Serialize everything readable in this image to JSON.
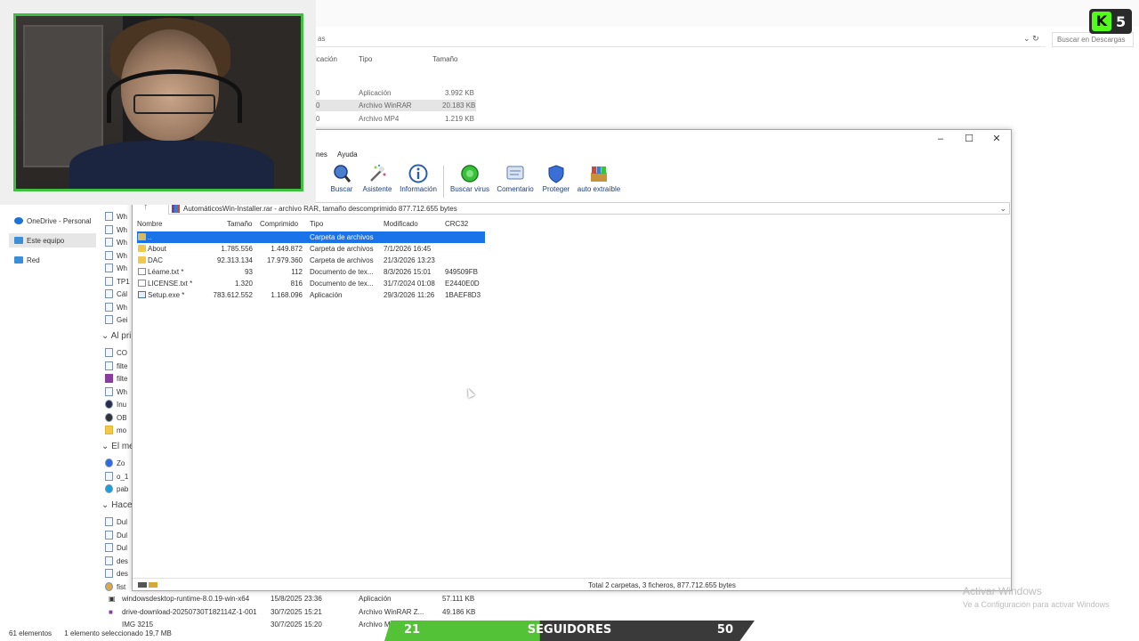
{
  "explorer": {
    "search_placeholder": "Buscar en Descargas",
    "address_fragment": "as",
    "columns": [
      "ificación",
      "Tipo",
      "Tamaño"
    ],
    "top_rows": [
      {
        "date_frag": "0",
        "type": "Aplicación",
        "size": "3.992 KB",
        "selected": false
      },
      {
        "date_frag": "0",
        "type": "Archivo WinRAR",
        "size": "20.183 KB",
        "selected": true
      },
      {
        "date_frag": "0",
        "type": "Archivo MP4",
        "size": "1.219 KB",
        "selected": false
      }
    ],
    "sidebar": [
      {
        "label": "OneDrive - Personal",
        "color": "#1e73d8"
      },
      {
        "label": "Este equipo",
        "color": "#3a8fd8",
        "selected": true
      },
      {
        "label": "Red",
        "color": "#3a8fd8"
      }
    ],
    "peek_items_top": [
      "Wh",
      "Wh",
      "Wh",
      "Wh",
      "Wh",
      "TP1",
      "Cál",
      "Wh",
      "Gei"
    ],
    "group_1": "Al pri",
    "peek_items_mid": [
      "CO",
      "filte",
      "filte",
      "Wh",
      "Inu",
      "OB",
      "mo"
    ],
    "group_2": "El me",
    "peek_items_mid2": [
      "Zo",
      "o_1",
      "pab"
    ],
    "group_3": "Hace",
    "peek_items_bot": [
      "Dul",
      "Dul",
      "Dul",
      "des",
      "des",
      "fist"
    ],
    "bottom_rows": [
      {
        "name": "windowsdesktop-runtime-8.0.19-win-x64",
        "date": "15/8/2025 23:36",
        "type": "Aplicación",
        "size": "57.111 KB"
      },
      {
        "name": "drive-download-20250730T182114Z-1-001",
        "date": "30/7/2025 15:21",
        "type": "Archivo WinRAR Z...",
        "size": "49.186 KB"
      },
      {
        "name": "IMG 3215",
        "date": "30/7/2025 15:20",
        "type": "Archivo MOV",
        "size": ""
      }
    ],
    "status_count": "61 elementos",
    "status_selected": "1 elemento seleccionado  19,7 MB"
  },
  "winrar": {
    "menu": [
      "nes",
      "Ayuda"
    ],
    "toolbar": [
      {
        "label": "r",
        "icon": "add-icon"
      },
      {
        "label": "Buscar",
        "icon": "search-icon"
      },
      {
        "label": "Asistente",
        "icon": "wizard-icon"
      },
      {
        "label": "Información",
        "icon": "info-icon"
      },
      {
        "label": "Buscar virus",
        "icon": "virus-scan-icon"
      },
      {
        "label": "Comentario",
        "icon": "comment-icon"
      },
      {
        "label": "Proteger",
        "icon": "protect-icon"
      },
      {
        "label": "auto extraíble",
        "icon": "sfx-icon"
      }
    ],
    "path": "AutomáticosWin-Installer.rar - archivo RAR, tamaño descomprimido 877.712.655 bytes",
    "columns": [
      "Nombre",
      "Tamaño",
      "Comprimido",
      "Tipo",
      "Modificado",
      "CRC32"
    ],
    "files": [
      {
        "name": "..",
        "size": "",
        "packed": "",
        "type": "Carpeta de archivos",
        "modified": "",
        "crc": "",
        "kind": "up",
        "selected": true
      },
      {
        "name": "About",
        "size": "1.785.556",
        "packed": "1.449.872",
        "type": "Carpeta de archivos",
        "modified": "7/1/2026 16:45",
        "crc": "",
        "kind": "folder",
        "selected": false
      },
      {
        "name": "DAC",
        "size": "92.313.134",
        "packed": "17.979.360",
        "type": "Carpeta de archivos",
        "modified": "21/3/2026 13:23",
        "crc": "",
        "kind": "folder",
        "selected": false
      },
      {
        "name": "Léame.txt *",
        "size": "93",
        "packed": "112",
        "type": "Documento de tex...",
        "modified": "8/3/2026 15:01",
        "crc": "949509FB",
        "kind": "txt",
        "selected": false
      },
      {
        "name": "LICENSE.txt *",
        "size": "1.320",
        "packed": "816",
        "type": "Documento de tex...",
        "modified": "31/7/2024 01:08",
        "crc": "E2440E0D",
        "kind": "txt",
        "selected": false
      },
      {
        "name": "Setup.exe *",
        "size": "783.612.552",
        "packed": "1.168.096",
        "type": "Aplicación",
        "modified": "29/3/2026 11:26",
        "crc": "1BAEF8D3",
        "kind": "exe",
        "selected": false
      }
    ],
    "status": "Total 2 carpetas, 3 ficheros, 877.712.655 bytes"
  },
  "kick_badge": {
    "letter": "K",
    "count": "5",
    "accent": "#53fc18"
  },
  "activate_windows": {
    "line1": "Activar Windows",
    "line2": "Ve a Configuración para activar Windows"
  },
  "followers_goal": {
    "current": 21,
    "current_label": "21",
    "label": "SEGUIDORES",
    "target": 50,
    "target_label": "50",
    "fill_color": "#53c236"
  }
}
